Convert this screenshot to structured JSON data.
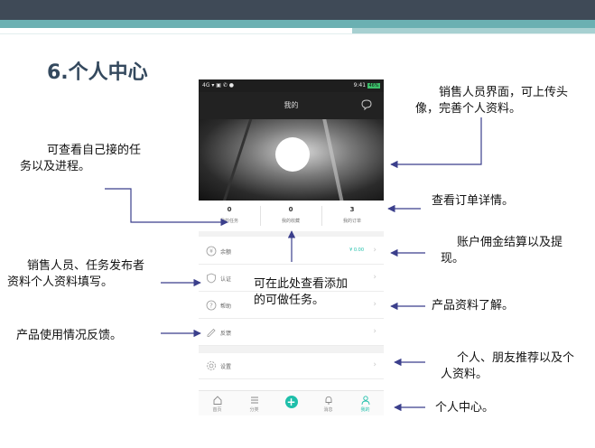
{
  "slide": {
    "title": "6.个人中心"
  },
  "status_bar": {
    "left": "4G ▾ ▣ ✆ ●",
    "time": "9:41",
    "battery": "46%"
  },
  "app_header": {
    "title": "我的"
  },
  "stats": [
    {
      "value": "0",
      "label": "我的任务"
    },
    {
      "value": "0",
      "label": "我的收藏"
    },
    {
      "value": "3",
      "label": "我的订单"
    }
  ],
  "menu": {
    "balance": {
      "label": "余额",
      "value": "¥ 0.00"
    },
    "verify": {
      "label": "认证"
    },
    "help": {
      "label": "帮助"
    },
    "feedback": {
      "label": "反馈"
    },
    "settings": {
      "label": "设置"
    }
  },
  "tabs": [
    {
      "label": "首页"
    },
    {
      "label": "分类"
    },
    {
      "label": ""
    },
    {
      "label": "消息"
    },
    {
      "label": "我的"
    }
  ],
  "annotations": {
    "profile_upload": "销售人员界面，可上传头像，完善个人资料。",
    "task_progress": "可查看自己接的任务以及进程。",
    "order_detail": "查看订单详情。",
    "commission": "账户佣金结算以及提现。",
    "seller_info": "销售人员、任务发布者资料个人资料填写。",
    "favorites": "可在此处查看添加的可做任务。",
    "product_info": "产品资料了解。",
    "usage_feedback": "产品使用情况反馈。",
    "recommend": "个人、朋友推荐以及个人资料。",
    "personal_center": "个人中心。"
  },
  "colors": {
    "accent": "#1fbfaa",
    "title": "#34495e",
    "band_dark": "#3f4a57",
    "band_teal": "#6bb0b2",
    "arrow": "#3b3f8c"
  }
}
